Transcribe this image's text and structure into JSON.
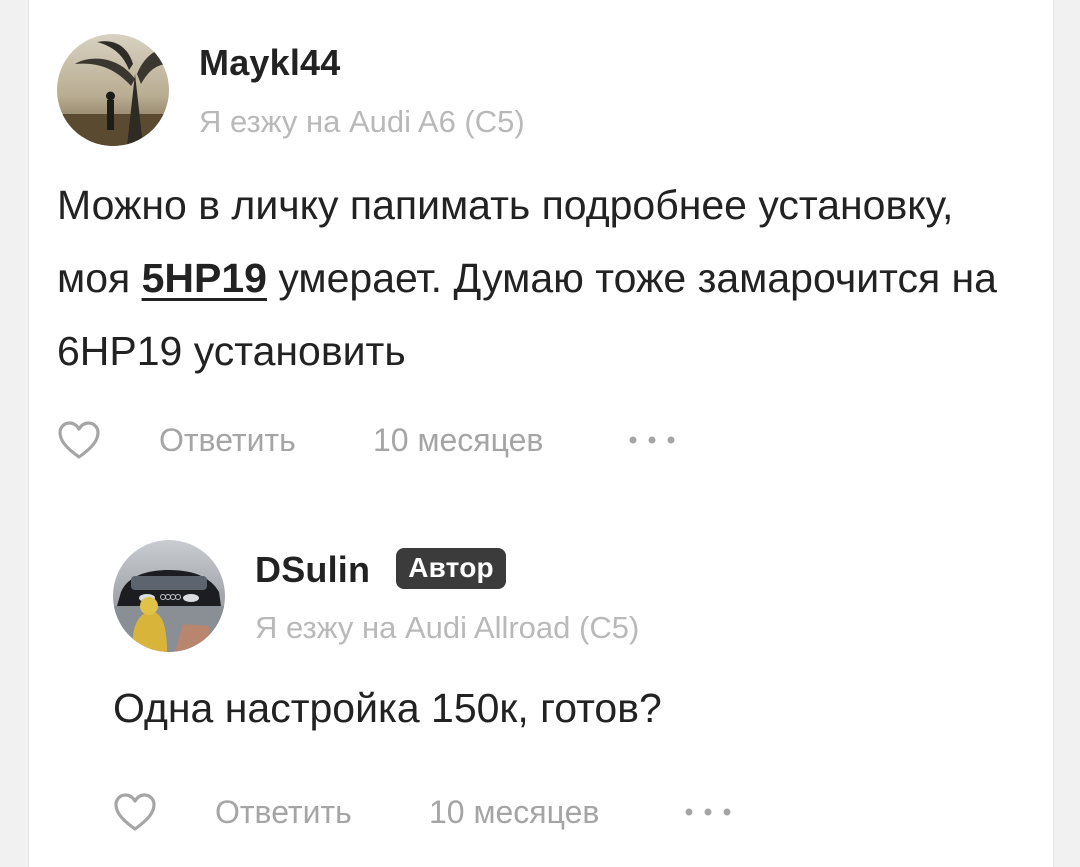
{
  "comments": [
    {
      "author": "Maykl44",
      "car": "Я езжу на Audi A6 (C5)",
      "text_before": "Можно в личку папимать подробнее установку, моя ",
      "mention": "5HP19",
      "text_after": " умерает. Думаю тоже замарочится на 6HP19 установить",
      "reply_label": "Ответить",
      "time": "10 месяцев",
      "avatar_icon": "man-under-tree-avatar"
    },
    {
      "author": "DSulin",
      "badge": "Автор",
      "car": "Я езжу на Audi Allroad (C5)",
      "text": "Одна настройка 150к, готов?",
      "reply_label": "Ответить",
      "time": "10 месяцев",
      "avatar_icon": "audi-car-avatar"
    }
  ],
  "icons": {
    "like": "heart-outline-icon",
    "more": "ellipsis-icon"
  },
  "colors": {
    "text": "#222222",
    "muted": "#a5a5a5",
    "badge_bg": "#3b3b3b"
  }
}
